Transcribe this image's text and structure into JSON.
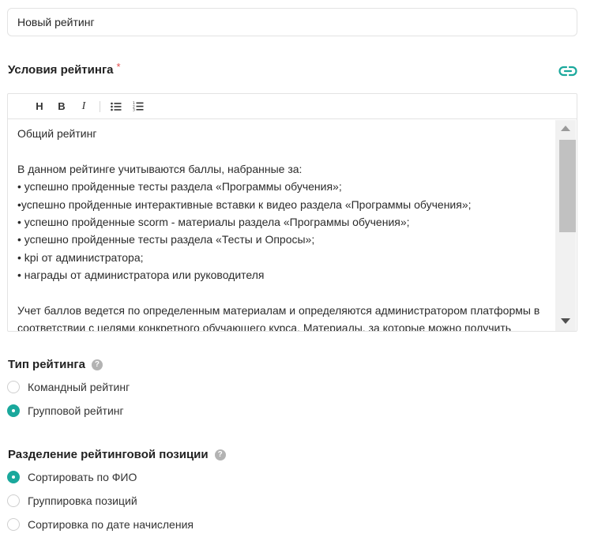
{
  "rating_name": {
    "value": "Новый рейтинг"
  },
  "conditions": {
    "title": "Условия рейтинга",
    "required_mark": "*",
    "icon": "link-icon",
    "toolbar": {
      "heading": "H",
      "bold": "B",
      "italic": "I",
      "bullet_list_icon": "bullet-list-icon",
      "numbered_list_icon": "numbered-list-icon"
    },
    "lines": [
      "Общий рейтинг",
      "",
      "В данном рейтинге учитываются баллы, набранные за:",
      "• успешно пройденные тесты раздела «Программы обучения»;",
      "•успешно пройденные интерактивные вставки к видео раздела «Программы обучения»;",
      "• успешно пройденные scorm - материалы раздела «Программы обучения»;",
      "• успешно пройденные тесты раздела «Тесты и Опросы»;",
      "• kpi от администратора;",
      "• награды от администратора или руководителя",
      "",
      "Учет баллов ведется по определенным материалам и определяются администратором платформы в соответствии с целями конкретного обучающего курса. Материалы, за которые можно получить"
    ]
  },
  "rating_type": {
    "title": "Тип рейтинга",
    "help_icon": "?",
    "options": [
      {
        "label": "Командный рейтинг",
        "checked": false
      },
      {
        "label": "Групповой рейтинг",
        "checked": true
      }
    ]
  },
  "position_split": {
    "title": "Разделение рейтинговой позиции",
    "help_icon": "?",
    "options": [
      {
        "label": "Сортировать по ФИО",
        "checked": true
      },
      {
        "label": "Группировка позиций",
        "checked": false
      },
      {
        "label": "Сортировка по дате начисления",
        "checked": false
      }
    ]
  },
  "colors": {
    "accent": "#1aa89c",
    "required": "#e24b4b",
    "border": "#e3e3e3"
  }
}
